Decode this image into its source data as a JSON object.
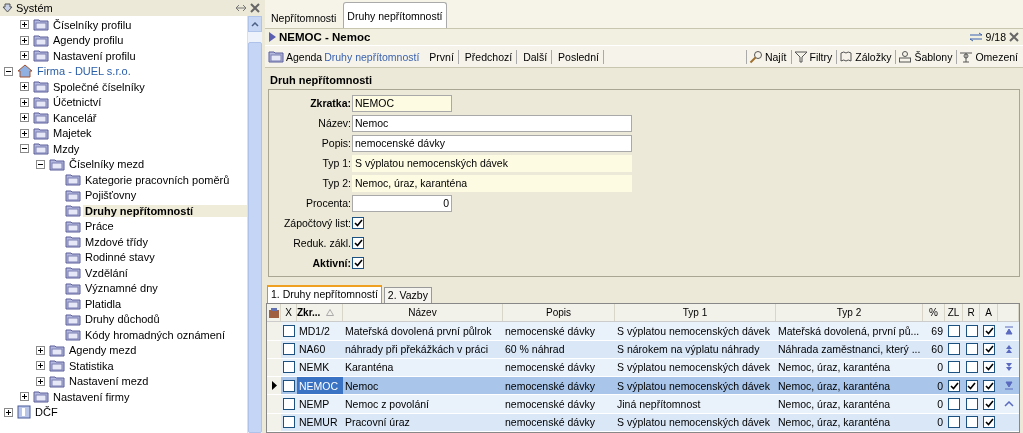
{
  "sidebar": {
    "title": "Systém",
    "tree": [
      {
        "children": [
          {
            "label": "Číselníky profilu",
            "kind": "folder",
            "expanded": false,
            "selected": false
          },
          {
            "label": "Agendy profilu",
            "kind": "folder",
            "expanded": false,
            "selected": false
          },
          {
            "label": "Nastavení profilu",
            "kind": "folder",
            "expanded": false,
            "selected": false
          }
        ]
      },
      {
        "label": "Firma - DUEL s.r.o.",
        "kind": "home",
        "expanded": true,
        "selected": false,
        "children": [
          {
            "label": "Společné číselníky",
            "kind": "folder",
            "expanded": false,
            "selected": false
          },
          {
            "label": "Účetnictví",
            "kind": "folder",
            "expanded": false,
            "selected": false
          },
          {
            "label": "Kancelář",
            "kind": "folder",
            "expanded": false,
            "selected": false
          },
          {
            "label": "Majetek",
            "kind": "folder",
            "expanded": false,
            "selected": false
          },
          {
            "label": "Mzdy",
            "kind": "folder",
            "expanded": true,
            "selected": false,
            "children": [
              {
                "label": "Číselníky mezd",
                "kind": "folder",
                "expanded": true,
                "selected": false,
                "children": [
                  {
                    "label": "Kategorie pracovních poměrů",
                    "kind": "leaf",
                    "selected": false
                  },
                  {
                    "label": "Pojišťovny",
                    "kind": "leaf",
                    "selected": false
                  },
                  {
                    "label": "Druhy nepřítomností",
                    "kind": "leaf",
                    "selected": true
                  },
                  {
                    "label": "Práce",
                    "kind": "leaf",
                    "selected": false
                  },
                  {
                    "label": "Mzdové třídy",
                    "kind": "leaf",
                    "selected": false
                  },
                  {
                    "label": "Rodinné stavy",
                    "kind": "leaf",
                    "selected": false
                  },
                  {
                    "label": "Vzdělání",
                    "kind": "leaf",
                    "selected": false
                  },
                  {
                    "label": "Významné dny",
                    "kind": "leaf",
                    "selected": false
                  },
                  {
                    "label": "Platidla",
                    "kind": "leaf",
                    "selected": false
                  },
                  {
                    "label": "Druhy důchodů",
                    "kind": "leaf",
                    "selected": false
                  },
                  {
                    "label": "Kódy hromadných oznámení",
                    "kind": "leaf",
                    "selected": false
                  }
                ]
              },
              {
                "label": "Agendy mezd",
                "kind": "folder",
                "expanded": false,
                "selected": false
              },
              {
                "label": "Statistika",
                "kind": "folder",
                "expanded": false,
                "selected": false
              },
              {
                "label": "Nastavení mezd",
                "kind": "folder",
                "expanded": false,
                "selected": false
              }
            ]
          },
          {
            "label": "Nastavení firmy",
            "kind": "folder",
            "expanded": false,
            "selected": false
          }
        ]
      },
      {
        "label": "DČF",
        "kind": "dcf",
        "expanded": false,
        "selected": false
      }
    ]
  },
  "tabs": [
    {
      "label": "Nepřítomnosti",
      "selected": false
    },
    {
      "label": "Druhy nepřítomností",
      "selected": true
    }
  ],
  "record": {
    "title": "NEMOC - Nemoc",
    "counter": "9/18"
  },
  "toolbar": {
    "agenda_label": "Agenda",
    "agenda_link": "Druhy nepřítomností",
    "nav": [
      "První",
      "Předchozí",
      "Další",
      "Poslední"
    ],
    "tools": [
      {
        "label": "Najít",
        "kind": "search"
      },
      {
        "label": "Filtry",
        "kind": "filter"
      },
      {
        "label": "Záložky",
        "kind": "bookmark"
      },
      {
        "label": "Šablony",
        "kind": "stamp"
      },
      {
        "label": "Omezení",
        "kind": "limit"
      }
    ]
  },
  "form": {
    "title": "Druh nepřítomnosti",
    "fields": [
      {
        "label": "Zkratka:",
        "kind": "code",
        "value": "NEMOC",
        "required": true
      },
      {
        "label": "Název:",
        "kind": "text",
        "value": "Nemoc",
        "required": false
      },
      {
        "label": "Popis:",
        "kind": "text",
        "value": "nemocenské dávky",
        "required": false
      },
      {
        "label": "Typ 1:",
        "kind": "info",
        "value": "S výplatou nemocenských dávek",
        "required": false
      },
      {
        "label": "Typ 2:",
        "kind": "info",
        "value": "Nemoc, úraz, karanténa",
        "required": false
      },
      {
        "label": "Procenta:",
        "kind": "number",
        "value": "0",
        "required": false
      },
      {
        "label": "Zápočtový list:",
        "kind": "checkbox",
        "checked": true,
        "required": false
      },
      {
        "label": "Reduk. zákl.",
        "kind": "checkbox",
        "checked": true,
        "required": false
      },
      {
        "label": "Aktivní:",
        "kind": "checkbox",
        "checked": true,
        "required": true
      }
    ]
  },
  "subtabs": [
    {
      "label": "1. Druhy nepřítomností",
      "selected": true
    },
    {
      "label": "2. Vazby",
      "selected": false
    }
  ],
  "table": {
    "select_header": "X",
    "columns": [
      "Zkr...",
      "Název",
      "Popis",
      "Typ 1",
      "Typ 2",
      "%",
      "ZL",
      "R",
      "A"
    ],
    "rows": [
      {
        "marked": false,
        "cells": [
          "MD1/2",
          "Mateřská dovolená první půlrok",
          "nemocenské dávky",
          "S výplatou nemocenských dávek",
          "Mateřská dovolená, první pů...",
          "69"
        ],
        "zl": false,
        "r": false,
        "a": true,
        "selected": false
      },
      {
        "marked": false,
        "cells": [
          "NA60",
          "náhrady při překážkách v práci",
          "60 % náhrad",
          "S nárokem na výplatu náhrady",
          "Náhrada zaměstnanci, který ...",
          "60"
        ],
        "zl": false,
        "r": false,
        "a": true,
        "selected": false
      },
      {
        "marked": false,
        "cells": [
          "NEMK",
          "Karanténa",
          "nemocenské dávky",
          "S výplatou nemocenských dávek",
          "Nemoc, úraz, karanténa",
          "0"
        ],
        "zl": false,
        "r": false,
        "a": true,
        "selected": false
      },
      {
        "marked": false,
        "cells": [
          "NEMOC",
          "Nemoc",
          "nemocenské dávky",
          "S výplatou nemocenských dávek",
          "Nemoc, úraz, karanténa",
          "0"
        ],
        "zl": true,
        "r": true,
        "a": true,
        "selected": true
      },
      {
        "marked": false,
        "cells": [
          "NEMP",
          "Nemoc z povolání",
          "nemocenské dávky",
          "Jiná nepřítomnost",
          "Nemoc, úraz, karanténa",
          "0"
        ],
        "zl": false,
        "r": false,
        "a": true,
        "selected": false
      },
      {
        "marked": false,
        "cells": [
          "NEMUR",
          "Pracovní úraz",
          "nemocenské dávky",
          "S výplatou nemocenských dávek",
          "Nemoc, úraz, karanténa",
          "0"
        ],
        "zl": false,
        "r": false,
        "a": true,
        "selected": false
      }
    ]
  }
}
